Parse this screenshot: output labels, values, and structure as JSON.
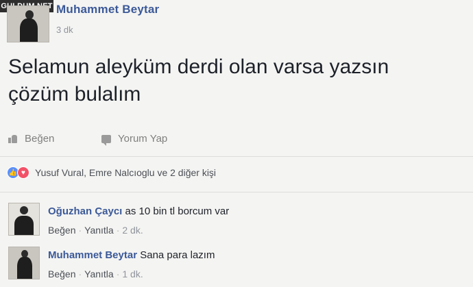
{
  "watermark": "GULDUM.NET",
  "post": {
    "author": "Muhammet Beytar",
    "time": "3 dk",
    "text_line1": "Selamun aleyküm derdi olan varsa yazsın",
    "text_line2": "çözüm bulalım"
  },
  "actions": {
    "like": "Beğen",
    "comment": "Yorum Yap"
  },
  "reactions": {
    "text": "Yusuf Vural, Emre Nalcıoglu ve 2 diğer kişi"
  },
  "comments": [
    {
      "author": "Oğuzhan Çaycı",
      "text": "as 10 bin tl borcum var",
      "like": "Beğen",
      "reply": "Yanıtla",
      "time": "2 dk."
    },
    {
      "author": "Muhammet Beytar",
      "text": "Sana para lazım",
      "like": "Beğen",
      "reply": "Yanıtla",
      "time": "1 dk."
    }
  ],
  "colors": {
    "link_blue": "#3b5998",
    "meta_gray": "#90949c",
    "like_blue": "#5890ff",
    "love_red": "#f25268"
  }
}
